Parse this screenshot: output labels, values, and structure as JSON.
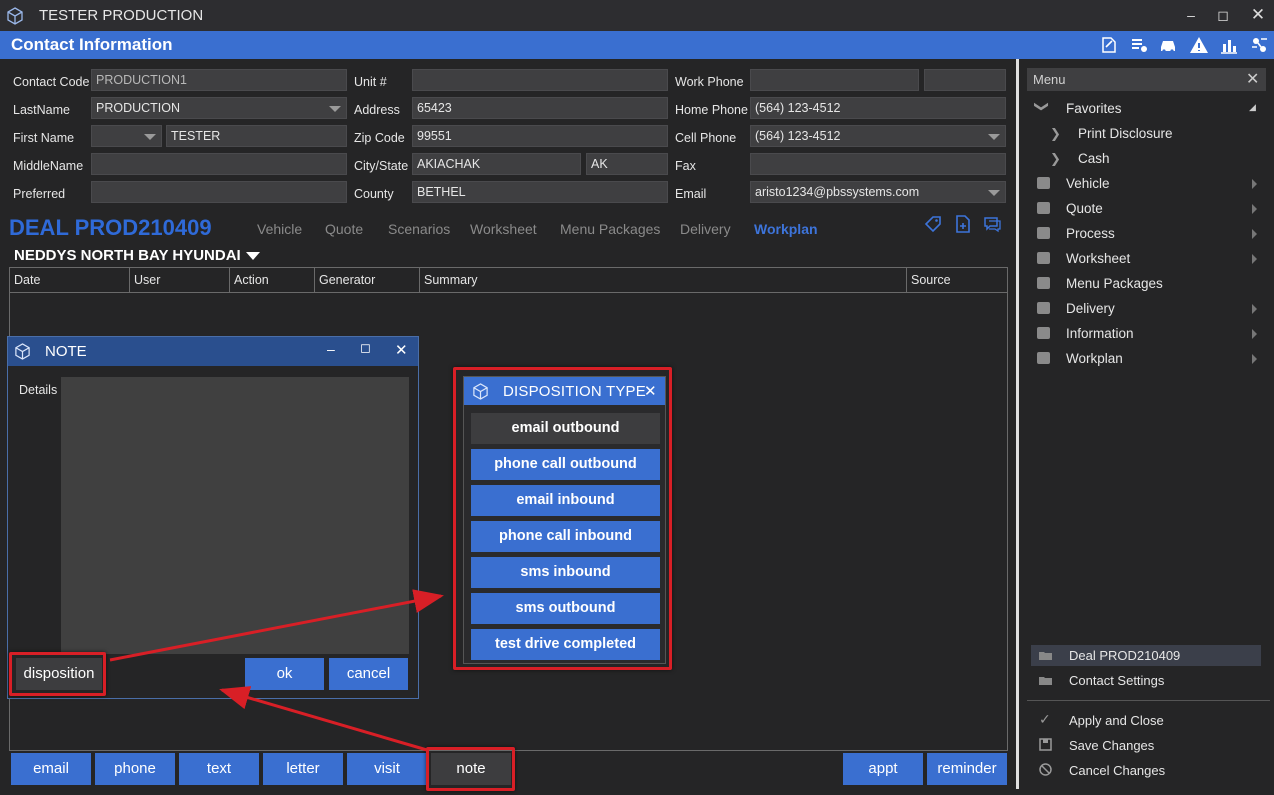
{
  "window": {
    "title": "TESTER PRODUCTION"
  },
  "header": {
    "title": "Contact Information"
  },
  "contact": {
    "contact_code_label": "Contact Code",
    "contact_code": "PRODUCTION1",
    "lastname_label": "LastName",
    "lastname": "PRODUCTION",
    "firstname_label": "First Name",
    "firstname": "TESTER",
    "middlename_label": "MiddleName",
    "middlename": "",
    "preferred_label": "Preferred",
    "preferred": "",
    "unit_label": "Unit #",
    "unit": "",
    "address_label": "Address",
    "address": "65423",
    "zip_label": "Zip Code",
    "zip": "99551",
    "citystate_label": "City/State",
    "city": "AKIACHAK",
    "state": "AK",
    "county_label": "County",
    "county": "BETHEL",
    "workphone_label": "Work Phone",
    "workphone": "",
    "workphone_ext": "",
    "homephone_label": "Home Phone",
    "homephone": "(564) 123-4512",
    "cellphone_label": "Cell Phone",
    "cellphone": "(564) 123-4512",
    "fax_label": "Fax",
    "fax": "",
    "email_label": "Email",
    "email": "aristo1234@pbssystems.com"
  },
  "deal": {
    "title": "DEAL PROD210409",
    "tabs": [
      "Vehicle",
      "Quote",
      "Scenarios",
      "Worksheet",
      "Menu Packages",
      "Delivery",
      "Workplan"
    ],
    "active_tab": "Workplan",
    "dealer": "NEDDYS NORTH BAY HYUNDAI"
  },
  "grid": {
    "columns": [
      "Date",
      "User",
      "Action",
      "Generator",
      "Summary",
      "Source"
    ]
  },
  "bottom_buttons": {
    "email": "email",
    "phone": "phone",
    "text": "text",
    "letter": "letter",
    "visit": "visit",
    "note": "note",
    "appt": "appt",
    "reminder": "reminder"
  },
  "note_dialog": {
    "title": "NOTE",
    "details_label": "Details",
    "details_value": "",
    "disposition": "disposition",
    "ok": "ok",
    "cancel": "cancel"
  },
  "disposition_dialog": {
    "title": "DISPOSITION TYPE",
    "options": [
      "email outbound",
      "phone call outbound",
      "email inbound",
      "phone call inbound",
      "sms inbound",
      "sms outbound",
      "test drive completed"
    ]
  },
  "menu": {
    "title": "Menu",
    "favorites": "Favorites",
    "favorites_children": [
      "Print Disclosure",
      "Cash"
    ],
    "items": [
      "Vehicle",
      "Quote",
      "Process",
      "Worksheet",
      "Menu Packages",
      "Delivery",
      "Information",
      "Workplan"
    ],
    "open_items": [
      "Deal PROD210409",
      "Contact Settings"
    ],
    "actions": [
      "Apply and Close",
      "Save Changes",
      "Cancel Changes"
    ]
  },
  "colors": {
    "accent": "#3a6fd0",
    "deal_title": "#2f6ad8",
    "highlight": "#d81f26",
    "background": "#252526"
  }
}
